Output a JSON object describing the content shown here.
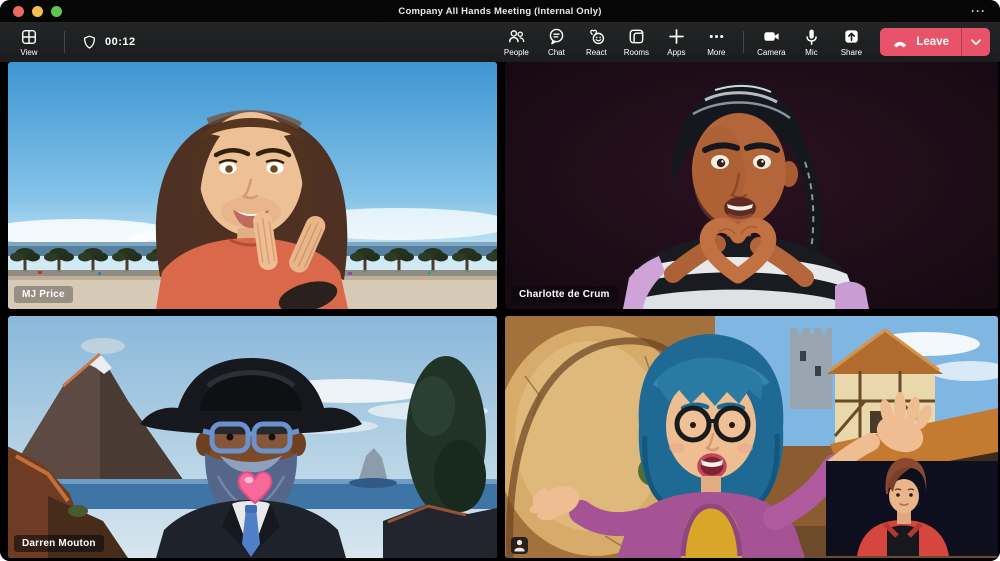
{
  "window": {
    "title": "Company All Hands Meeting (Internal Only)",
    "overflow": "···"
  },
  "toolbar": {
    "view": {
      "label": "View",
      "icon": "grid-view-icon"
    },
    "timer": {
      "value": "00:12",
      "icon": "shield-icon"
    },
    "actions": [
      {
        "id": "people",
        "label": "People",
        "icon": "people-icon"
      },
      {
        "id": "chat",
        "label": "Chat",
        "icon": "chat-icon"
      },
      {
        "id": "react",
        "label": "React",
        "icon": "react-icon"
      },
      {
        "id": "rooms",
        "label": "Rooms",
        "icon": "rooms-icon"
      },
      {
        "id": "apps",
        "label": "Apps",
        "icon": "plus-icon"
      },
      {
        "id": "more",
        "label": "More",
        "icon": "ellipsis-icon"
      },
      {
        "id": "camera",
        "label": "Camera",
        "icon": "camera-icon"
      },
      {
        "id": "mic",
        "label": "Mic",
        "icon": "mic-icon"
      },
      {
        "id": "share",
        "label": "Share",
        "icon": "share-icon"
      }
    ],
    "leave": {
      "label": "Leave",
      "icon": "hangup-icon"
    }
  },
  "meeting": {
    "participants": [
      {
        "name": "MJ Price",
        "position": "top-left"
      },
      {
        "name": "Charlotte de Crum",
        "position": "top-right"
      },
      {
        "name": "Darren Mouton",
        "position": "bottom-left"
      },
      {
        "name": "",
        "position": "bottom-right",
        "self_view": true
      }
    ]
  },
  "colors": {
    "leave_button": "#e8536a",
    "titlebar": "#060607",
    "toolbar": "#1d1f20",
    "traffic_red": "#ed6a5e",
    "traffic_yellow": "#f4bf4f",
    "traffic_green": "#61c554"
  }
}
